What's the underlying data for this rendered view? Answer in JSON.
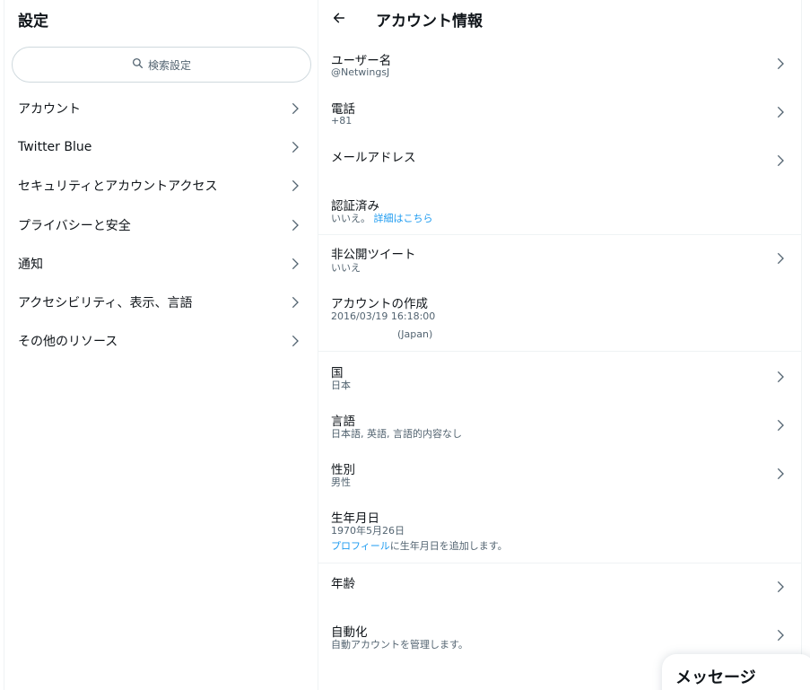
{
  "left": {
    "title": "設定",
    "search_placeholder": "検索設定",
    "items": [
      {
        "label": "アカウント"
      },
      {
        "label": "Twitter Blue"
      },
      {
        "label": "セキュリティとアカウントアクセス"
      },
      {
        "label": "プライバシーと安全"
      },
      {
        "label": "通知"
      },
      {
        "label": "アクセシビリティ、表示、言語"
      },
      {
        "label": "その他のリソース"
      }
    ]
  },
  "header": {
    "title": "アカウント情報"
  },
  "rows": {
    "username": {
      "label": "ユーザー名",
      "value": "@NetwingsJ"
    },
    "phone": {
      "label": "電話",
      "value": "+81"
    },
    "email": {
      "label": "メールアドレス"
    },
    "verified": {
      "label": "認証済み",
      "value": "いいえ。",
      "link": "詳細はこちら"
    },
    "protected": {
      "label": "非公開ツイート",
      "value": "いいえ"
    },
    "created": {
      "label": "アカウントの作成",
      "value": "2016/03/19 16:18:00",
      "value2": "(Japan)"
    },
    "country": {
      "label": "国",
      "value": "日本"
    },
    "languages": {
      "label": "言語",
      "value": "日本語, 英語, 言語的内容なし"
    },
    "gender": {
      "label": "性別",
      "value": "男性"
    },
    "birthdate": {
      "label": "生年月日",
      "value": "1970年5月26日",
      "link": "プロフィール",
      "link_suffix": "に生年月日を追加します。"
    },
    "age": {
      "label": "年齢"
    },
    "automation": {
      "label": "自動化",
      "value": "自動アカウントを管理します。"
    }
  },
  "messages": {
    "label": "メッセージ"
  },
  "colors": {
    "accent": "#1d9bf0",
    "secondary_text": "#536471",
    "divider": "#eff3f4"
  },
  "icons": {
    "search": "search-icon",
    "chevron": "chevron-right-icon",
    "back": "arrow-left-icon"
  }
}
